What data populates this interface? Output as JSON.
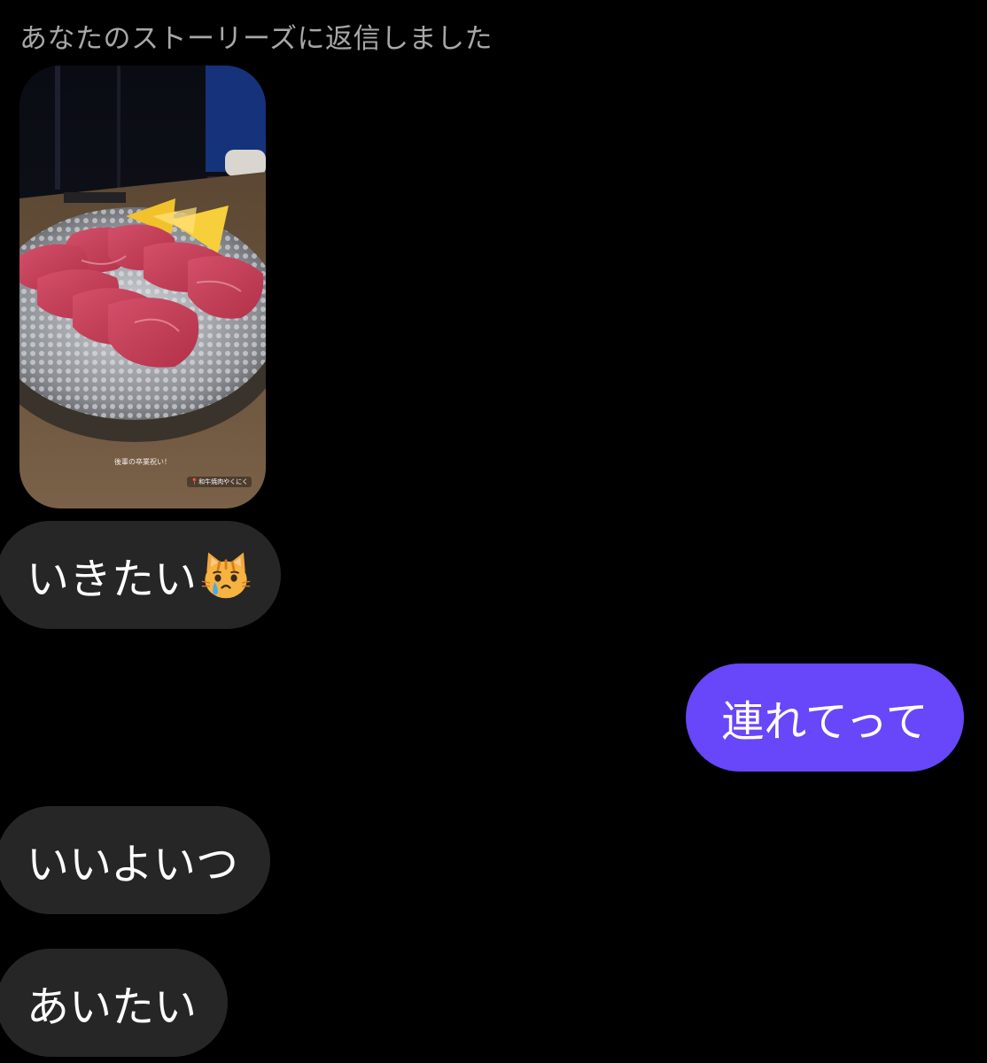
{
  "thread": {
    "reply_note": "あなたのストーリーズに返信しました",
    "story": {
      "caption": "後輩の卒業祝い！",
      "location_tag": "📍和牛焼肉やくにく",
      "image_subject": "beef-tongue-plate-photo"
    },
    "messages": [
      {
        "direction": "incoming",
        "text": "いきたい",
        "emoji": "crying-cat-emoji"
      },
      {
        "direction": "outgoing",
        "text": "連れてって"
      },
      {
        "direction": "incoming",
        "text": "いいよいつ"
      },
      {
        "direction": "incoming",
        "text": "あいたい"
      }
    ]
  },
  "colors": {
    "background": "#000000",
    "incoming_bubble": "#262626",
    "outgoing_bubble": "#6846f9",
    "note_text": "#a8a8a8"
  }
}
